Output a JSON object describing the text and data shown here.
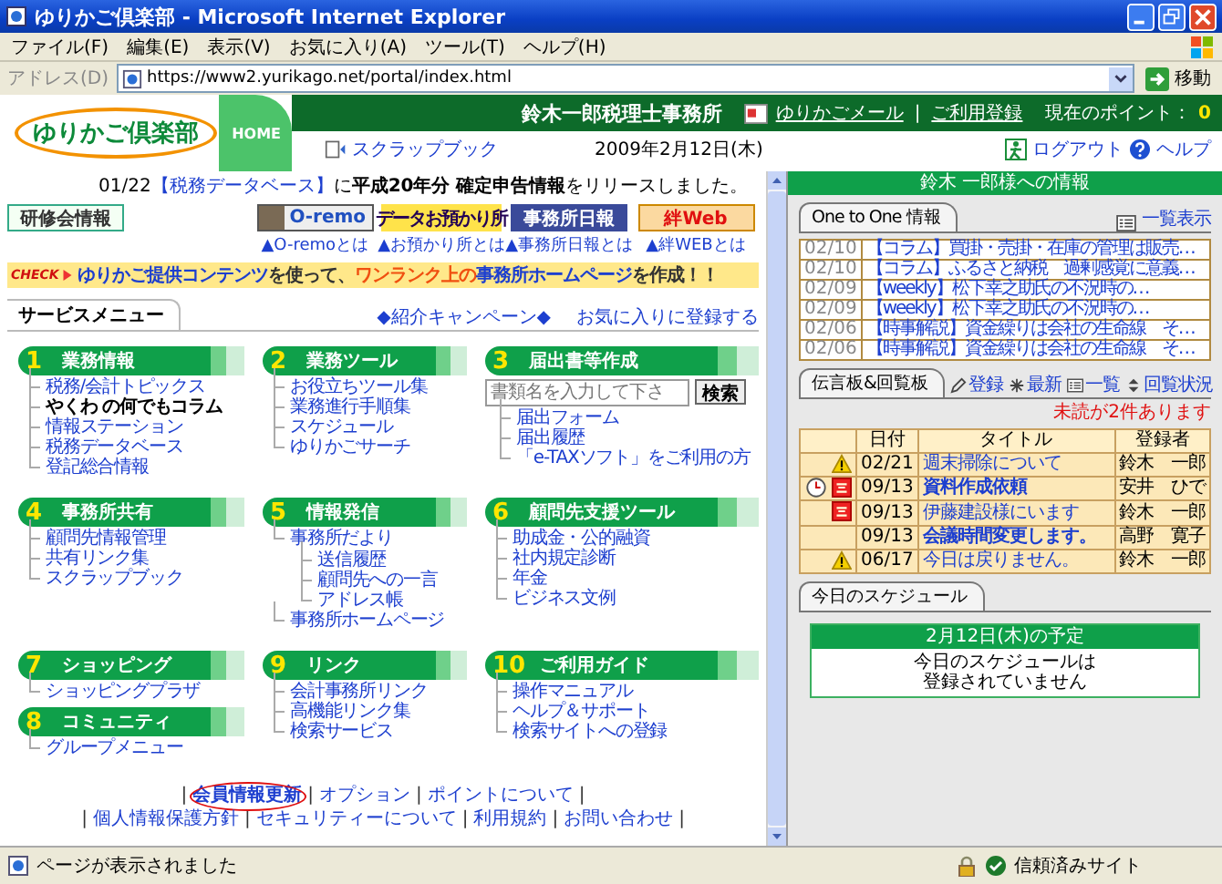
{
  "window": {
    "title": "ゆりかご倶楽部 - Microsoft Internet Explorer"
  },
  "menu": [
    "ファイル(F)",
    "編集(E)",
    "表示(V)",
    "お気に入り(A)",
    "ツール(T)",
    "ヘルプ(H)"
  ],
  "address_bar": {
    "label": "アドレス(D)",
    "url": "https://www2.yurikago.net/portal/index.html",
    "go": "移動"
  },
  "header": {
    "logo": "ゆりかご倶楽部",
    "home": "HOME",
    "office": "鈴木一郎税理士事務所",
    "mail": "ゆりかごメール",
    "separator": "|",
    "register": "ご利用登録",
    "points_label": "現在のポイント：",
    "points": "0",
    "scrapbook": "スクラップブック",
    "date": "2009年2月12日(木)",
    "logout": "ログアウト",
    "help": "ヘルプ"
  },
  "news": {
    "date": "01/22",
    "link": "【税務データベース】",
    "text": "に**平成20年分 確定申告情報**をリリースしました。"
  },
  "banners": [
    {
      "kind": "training",
      "label": "研修会情報"
    },
    {
      "kind": "oremo",
      "label": "O-remo",
      "link": "▲O-remoとは"
    },
    {
      "kind": "storage",
      "label": "データお預かり所",
      "link": "▲お預かり所とは"
    },
    {
      "kind": "daily",
      "label": "事務所日報",
      "link": "▲事務所日報とは"
    },
    {
      "kind": "kizuna",
      "label": "絆Web",
      "link": "▲絆WEBとは"
    }
  ],
  "promo": {
    "badge": "CHECK",
    "parts": [
      {
        "kind": "link",
        "text": "ゆりかご提供コンテンツ"
      },
      {
        "kind": "plain",
        "text": "を使って、"
      },
      {
        "kind": "accent",
        "text": "ワンランク上の"
      },
      {
        "kind": "link",
        "text": "事務所ホームページ"
      },
      {
        "kind": "plain",
        "text": "を作成！！"
      }
    ]
  },
  "service_menu": {
    "title": "サービスメニュー",
    "campaign": "◆紹介キャンペーン◆",
    "favorite": "お気に入りに登録する",
    "rows": [
      [
        [
          {
            "number": "1",
            "title": "業務情報",
            "items": [
              {
                "label": "税務/会計トピックス",
                "bold": false
              },
              {
                "label": "やくわ の何でもコラム",
                "bold": true
              },
              {
                "label": "情報ステーション",
                "bold": false
              },
              {
                "label": "税務データベース",
                "bold": false
              },
              {
                "label": "登記総合情報",
                "bold": false
              }
            ]
          }
        ],
        [
          {
            "number": "2",
            "title": "業務ツール",
            "items": [
              {
                "label": "お役立ちツール集",
                "bold": false
              },
              {
                "label": "業務進行手順集",
                "bold": false
              },
              {
                "label": "スケジュール",
                "bold": false
              },
              {
                "label": "ゆりかごサーチ",
                "bold": false
              }
            ]
          }
        ],
        [
          {
            "number": "3",
            "title": "届出書等作成",
            "search": {
              "placeholder": "書類名を入力して下さ",
              "button": "検索"
            },
            "items": [
              {
                "label": "届出フォーム",
                "bold": false
              },
              {
                "label": "届出履歴",
                "bold": false
              },
              {
                "label": "「e-TAXソフト」をご利用の方",
                "bold": false
              }
            ]
          }
        ]
      ],
      [
        [
          {
            "number": "4",
            "title": "事務所共有",
            "items": [
              {
                "label": "顧問先情報管理",
                "bold": false
              },
              {
                "label": "共有リンク集",
                "bold": false
              },
              {
                "label": "スクラップブック",
                "bold": false
              }
            ]
          }
        ],
        [
          {
            "number": "5",
            "title": "情報発信",
            "items": [
              {
                "label": "事務所だより",
                "bold": false,
                "children": [
                  {
                    "label": "送信履歴",
                    "bold": false
                  },
                  {
                    "label": "顧問先への一言",
                    "bold": false
                  },
                  {
                    "label": "アドレス帳",
                    "bold": false
                  }
                ]
              },
              {
                "label": "事務所ホームページ",
                "bold": false
              }
            ]
          }
        ],
        [
          {
            "number": "6",
            "title": "顧問先支援ツール",
            "items": [
              {
                "label": "助成金・公的融資",
                "bold": false
              },
              {
                "label": "社内規定診断",
                "bold": false
              },
              {
                "label": "年金",
                "bold": false
              },
              {
                "label": "ビジネス文例",
                "bold": false
              }
            ]
          }
        ]
      ],
      [
        [
          {
            "number": "7",
            "title": "ショッピング",
            "items": [
              {
                "label": "ショッピングプラザ",
                "bold": false
              }
            ]
          },
          {
            "number": "8",
            "title": "コミュニティ",
            "items": [
              {
                "label": "グループメニュー",
                "bold": false
              }
            ]
          }
        ],
        [
          {
            "number": "9",
            "title": "リンク",
            "items": [
              {
                "label": "会計事務所リンク",
                "bold": false
              },
              {
                "label": "高機能リンク集",
                "bold": false
              },
              {
                "label": "検索サービス",
                "bold": false
              }
            ]
          }
        ],
        [
          {
            "number": "10",
            "title": "ご利用ガイド",
            "items": [
              {
                "label": "操作マニュアル",
                "bold": false
              },
              {
                "label": "ヘルプ＆サポート",
                "bold": false
              },
              {
                "label": "検索サイトへの登録",
                "bold": false
              }
            ]
          }
        ]
      ]
    ]
  },
  "footer": {
    "separator": "|",
    "rows": [
      [
        {
          "label": "会員情報更新",
          "circled": true
        },
        {
          "label": "オプション",
          "circled": false
        },
        {
          "label": "ポイントについて",
          "circled": false
        }
      ],
      [
        {
          "label": "個人情報保護方針",
          "circled": false
        },
        {
          "label": "セキュリティーについて",
          "circled": false
        },
        {
          "label": "利用規約",
          "circled": false
        },
        {
          "label": "お問い合わせ",
          "circled": false
        }
      ]
    ]
  },
  "right_panel": {
    "title": "鈴木 一郎様への情報",
    "one_to_one": {
      "tab": "One to One 情報",
      "list_link": "一覧表示",
      "rows": [
        {
          "date": "02/10",
          "title": "【コラム】買掛・売掛・在庫の管理は販売…"
        },
        {
          "date": "02/10",
          "title": "【コラム】ふるさと納税　過剰感覚に意義…"
        },
        {
          "date": "02/09",
          "title": "【weekly】松下幸之助氏の不況時の…"
        },
        {
          "date": "02/09",
          "title": "【weekly】松下幸之助氏の不況時の…"
        },
        {
          "date": "02/06",
          "title": "【時事解説】資金繰りは会社の生命線　そ…"
        },
        {
          "date": "02/06",
          "title": "【時事解説】資金繰りは会社の生命線　そ…"
        }
      ]
    },
    "board": {
      "tab": "伝言板&回覧板",
      "actions": [
        {
          "kind": "add",
          "label": "登録"
        },
        {
          "kind": "latest",
          "label": "最新"
        },
        {
          "kind": "list",
          "label": "一覧"
        },
        {
          "kind": "status",
          "label": "回覧状況"
        }
      ],
      "unread_notice": "未読が2件あります",
      "columns": [
        "日付",
        "タイトル",
        "登録者"
      ],
      "rows": [
        {
          "clock": false,
          "urgent": false,
          "warning": true,
          "date": "02/21",
          "title": "週末掃除について",
          "author": "鈴木　一郎",
          "unread": false
        },
        {
          "clock": true,
          "urgent": true,
          "warning": false,
          "date": "09/13",
          "title": "資料作成依頼",
          "author": "安井　ひで",
          "unread": true
        },
        {
          "clock": false,
          "urgent": true,
          "warning": false,
          "date": "09/13",
          "title": "伊藤建設様にいます",
          "author": "鈴木　一郎",
          "unread": false
        },
        {
          "clock": false,
          "urgent": false,
          "warning": false,
          "date": "09/13",
          "title": "会議時間変更します。",
          "author": "高野　寛子",
          "unread": true
        },
        {
          "clock": false,
          "urgent": false,
          "warning": true,
          "date": "06/17",
          "title": "今日は戻りません。",
          "author": "鈴木　一郎",
          "unread": false
        }
      ]
    },
    "schedule": {
      "tab": "今日のスケジュール",
      "heading": "2月12日(木)の予定",
      "message_lines": [
        "今日のスケジュールは",
        "登録されていません"
      ]
    }
  },
  "status_bar": {
    "text": "ページが表示されました",
    "zone": "信頼済みサイト"
  }
}
